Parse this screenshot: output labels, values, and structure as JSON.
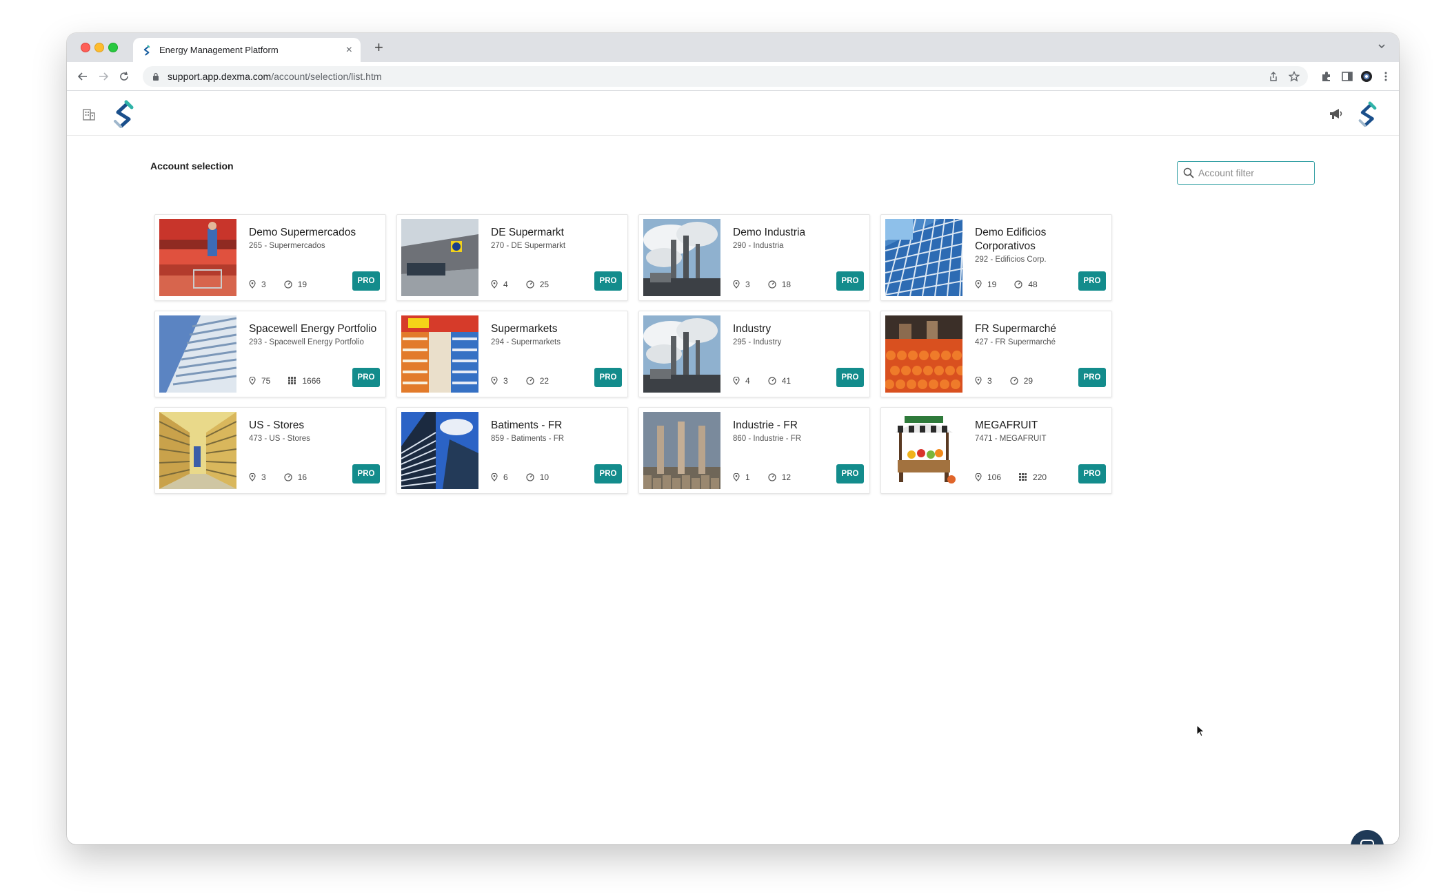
{
  "browser": {
    "tab_title": "Energy Management Platform",
    "tab_close": "×",
    "new_tab": "+",
    "url_host": "support.app.dexma.com",
    "url_path": "/account/selection/list.htm"
  },
  "page": {
    "title": "Account selection",
    "filter_placeholder": "Account filter"
  },
  "icons": {
    "location": "map-pin-icon",
    "meter": "gauge-icon",
    "grid": "grid-icon",
    "buildings": "buildings-icon",
    "announce": "megaphone-icon"
  },
  "accounts": [
    {
      "name": "Demo Supermercados",
      "sub": "265 - Supermercados",
      "locations": "3",
      "second": "19",
      "second_icon": "gauge-icon",
      "badge": "PRO",
      "image": "supermarket-produce"
    },
    {
      "name": "DE Supermarkt",
      "sub": "270 - DE Supermarkt",
      "locations": "4",
      "second": "25",
      "second_icon": "gauge-icon",
      "badge": "PRO",
      "image": "store-facade"
    },
    {
      "name": "Demo Industria",
      "sub": "290 - Industria",
      "locations": "3",
      "second": "18",
      "second_icon": "gauge-icon",
      "badge": "PRO",
      "image": "factory-smoke"
    },
    {
      "name": "Demo Edificios Corporativos",
      "sub": "292 - Edificios Corp.",
      "locations": "19",
      "second": "48",
      "second_icon": "gauge-icon",
      "badge": "PRO",
      "image": "glass-building"
    },
    {
      "name": "Spacewell Energy Portfolio",
      "sub": "293 - Spacewell Energy Portfolio",
      "locations": "75",
      "second": "1666",
      "second_icon": "grid-icon",
      "badge": "PRO",
      "image": "office-building"
    },
    {
      "name": "Supermarkets",
      "sub": "294 - Supermarkets",
      "locations": "3",
      "second": "22",
      "second_icon": "gauge-icon",
      "badge": "PRO",
      "image": "supermarket-aisle"
    },
    {
      "name": "Industry",
      "sub": "295 - Industry",
      "locations": "4",
      "second": "41",
      "second_icon": "gauge-icon",
      "badge": "PRO",
      "image": "factory-smoke"
    },
    {
      "name": "FR Supermarché",
      "sub": "427 - FR Supermarché",
      "locations": "3",
      "second": "29",
      "second_icon": "gauge-icon",
      "badge": "PRO",
      "image": "market-produce"
    },
    {
      "name": "US - Stores",
      "sub": "473 - US - Stores",
      "locations": "3",
      "second": "16",
      "second_icon": "gauge-icon",
      "badge": "PRO",
      "image": "store-aisle"
    },
    {
      "name": "Batiments - FR",
      "sub": "859 - Batiments - FR",
      "locations": "6",
      "second": "10",
      "second_icon": "gauge-icon",
      "badge": "PRO",
      "image": "skyscraper-sky"
    },
    {
      "name": "Industrie - FR",
      "sub": "860 - Industrie - FR",
      "locations": "1",
      "second": "12",
      "second_icon": "gauge-icon",
      "badge": "PRO",
      "image": "chimneys"
    },
    {
      "name": "MEGAFRUIT",
      "sub": "7471 - MEGAFRUIT",
      "locations": "106",
      "second": "220",
      "second_icon": "grid-icon",
      "badge": "PRO",
      "image": "fruit-stand"
    }
  ]
}
